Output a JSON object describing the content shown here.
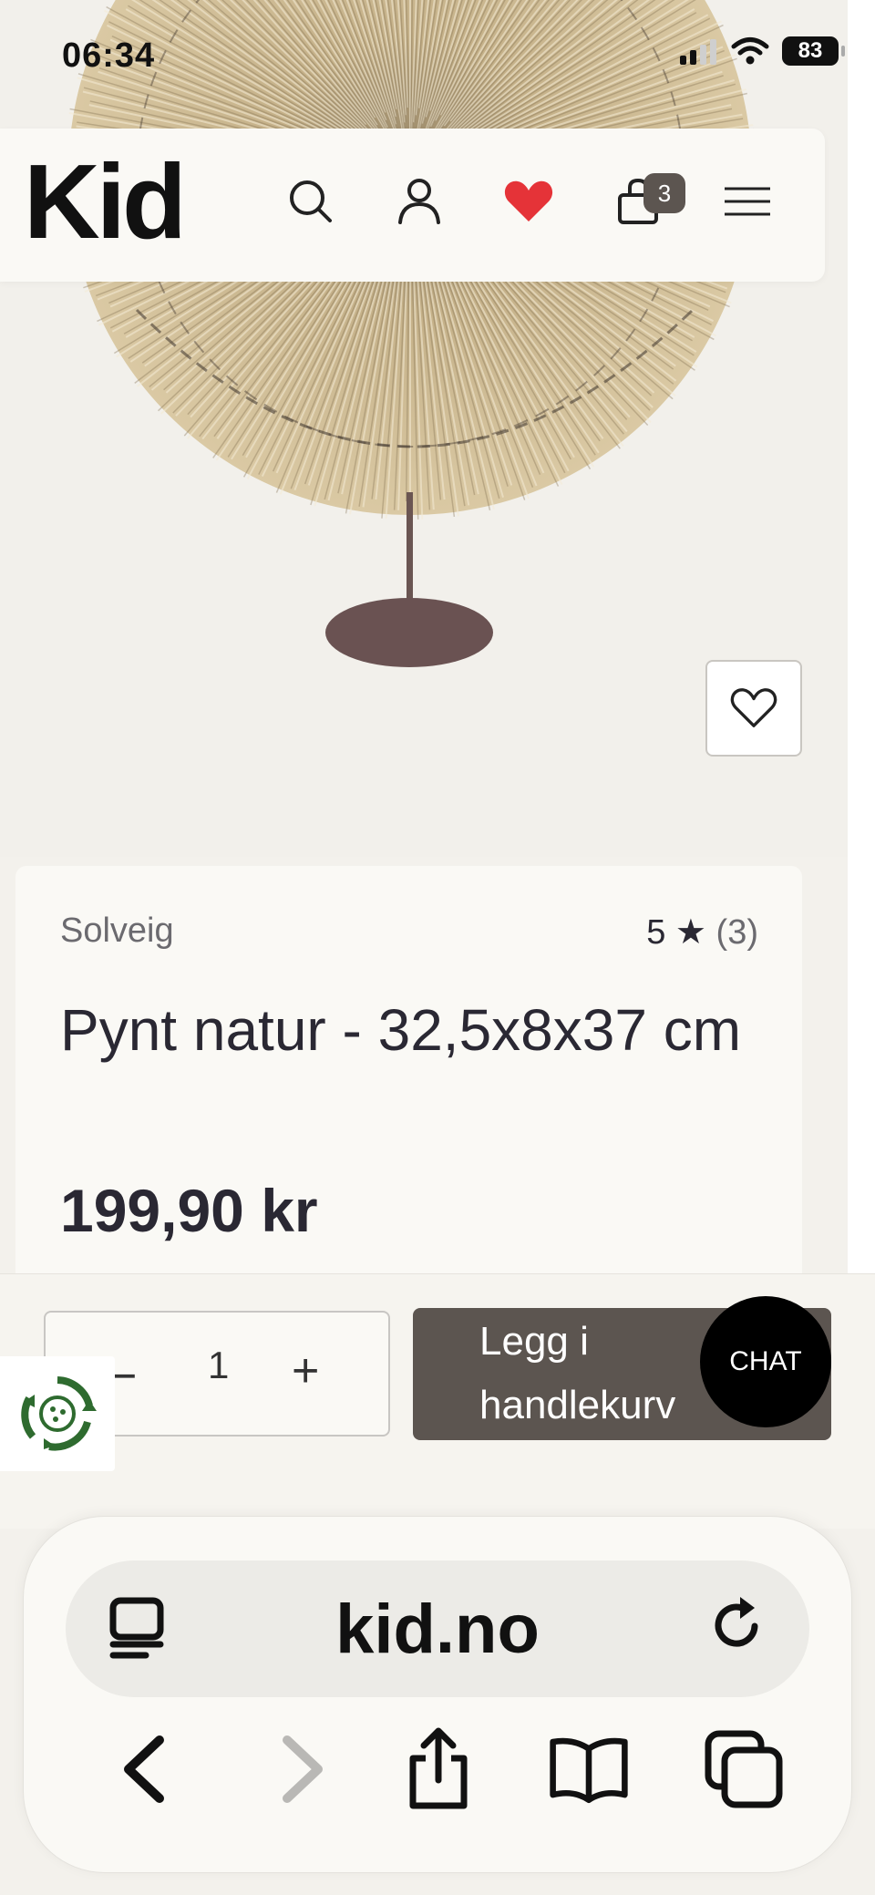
{
  "status_bar": {
    "time": "06:34",
    "battery": "83",
    "icons": [
      "signal-icon",
      "wifi-icon",
      "battery-icon"
    ]
  },
  "header": {
    "logo": "Kid",
    "cart_count": "3",
    "icons": [
      "search-icon",
      "account-icon",
      "wishlist-heart-icon",
      "cart-bag-icon",
      "menu-icon"
    ],
    "wishlist_color": "#e53338"
  },
  "product": {
    "brand": "Solveig",
    "rating_value": "5",
    "rating_star": "★",
    "rating_count": "(3)",
    "title": "Pynt natur - 32,5x8x37 cm",
    "price": "199,90 kr"
  },
  "cart_bar": {
    "qty_minus": "−",
    "quantity": "1",
    "qty_plus": "+",
    "add_to_cart_line1": "Legg i",
    "add_to_cart_line2": "handlekurv",
    "button_color": "#5c5550"
  },
  "chat": {
    "label": "CHAT"
  },
  "browser": {
    "url": "kid.no",
    "icons": [
      "reader-icon",
      "reload-icon",
      "back-icon",
      "forward-icon",
      "share-icon",
      "bookmarks-icon",
      "tabs-icon"
    ]
  },
  "colors": {
    "background": "#f3f1ec",
    "card": "#faf9f5",
    "text": "#2a2833",
    "muted": "#6b6a6f"
  }
}
